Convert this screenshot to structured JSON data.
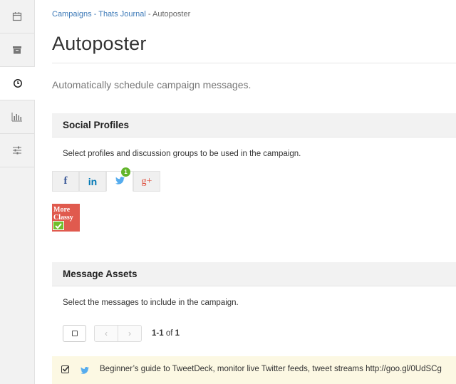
{
  "sidebar": {
    "items": [
      {
        "icon": "calendar-icon",
        "active": false
      },
      {
        "icon": "archive-icon",
        "active": false
      },
      {
        "icon": "clock-icon",
        "active": true
      },
      {
        "icon": "bar-chart-icon",
        "active": false
      },
      {
        "icon": "sliders-icon",
        "active": false
      }
    ]
  },
  "breadcrumb": {
    "link1": "Campaigns",
    "sep1": " - ",
    "link2": "Thats Journal",
    "sep2": " - ",
    "current": "Autoposter"
  },
  "page": {
    "title": "Autoposter",
    "subtitle": "Automatically schedule campaign messages."
  },
  "social_profiles": {
    "heading": "Social Profiles",
    "description": "Select profiles and discussion groups to be used in the campaign.",
    "tabs": [
      {
        "name": "facebook",
        "glyph": "f"
      },
      {
        "name": "linkedin",
        "glyph": "in"
      },
      {
        "name": "twitter",
        "glyph": "",
        "badge": "1",
        "active": true
      },
      {
        "name": "google-plus",
        "glyph": "g+"
      }
    ],
    "profile": {
      "label": "More Classy",
      "selected": true
    }
  },
  "message_assets": {
    "heading": "Message Assets",
    "description": "Select the messages to include in the campaign.",
    "pager": {
      "range": "1-1",
      "of_label": "of",
      "total": "1"
    },
    "rows": [
      {
        "selected": true,
        "network": "twitter",
        "text": "Beginner’s guide to TweetDeck, monitor live Twitter feeds, tweet streams http://goo.gl/0UdSCg"
      }
    ]
  },
  "colors": {
    "link": "#3d7ab8",
    "badge": "#62b52b",
    "twitter": "#55acee",
    "facebook": "#3b5998",
    "linkedin": "#0077b5",
    "google_plus": "#dd4b39",
    "row_highlight": "#fcf8e3"
  }
}
